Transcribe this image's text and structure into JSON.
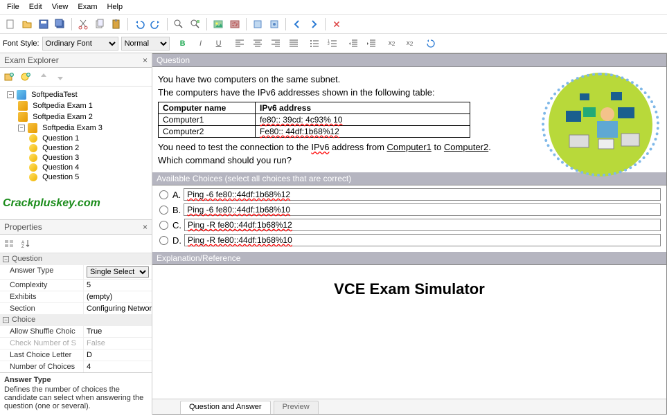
{
  "menu": {
    "file": "File",
    "edit": "Edit",
    "view": "View",
    "exam": "Exam",
    "help": "Help"
  },
  "format": {
    "fontstyle_label": "Font Style:",
    "fontstyle_value": "Ordinary Font",
    "fontsize_value": "Normal"
  },
  "explorer": {
    "title": "Exam Explorer",
    "root": "SoftpediaTest",
    "exams": [
      "Softpedia Exam 1",
      "Softpedia Exam 2",
      "Softpedia Exam 3"
    ],
    "questions": [
      "Question 1",
      "Question 2",
      "Question 3",
      "Question 4",
      "Question 5"
    ]
  },
  "watermark": "Crackpluskey.com",
  "properties": {
    "title": "Properties",
    "cat1": "Question",
    "rows1": [
      {
        "name": "Answer Type",
        "value": "Single Select",
        "select": true
      },
      {
        "name": "Complexity",
        "value": "5"
      },
      {
        "name": "Exhibits",
        "value": "(empty)"
      },
      {
        "name": "Section",
        "value": "Configuring Network C"
      }
    ],
    "cat2": "Choice",
    "rows2": [
      {
        "name": "Allow Shuffle Choic",
        "value": "True"
      },
      {
        "name": "Check Number of S",
        "value": "False",
        "disabled": true
      },
      {
        "name": "Last Choice Letter",
        "value": "D"
      },
      {
        "name": "Number of Choices",
        "value": "4"
      }
    ],
    "help_title": "Answer Type",
    "help_text": "Defines the number of choices the candidate can select when answering the question (one or several)."
  },
  "question": {
    "header": "Question",
    "p1": "You have two computers on the same subnet.",
    "p2": "The computers have the IPv6 addresses shown in the following table:",
    "table": {
      "h1": "Computer name",
      "h2": "IPv6 address",
      "r1c1": "Computer1",
      "r1c2": "fe80:: 39cd: 4c93% 10",
      "r2c1": "Computer2",
      "r2c2": "Fe80:: 44df:1b68%12"
    },
    "p3a": "You need to test the connection to the ",
    "p3b": "IPv6",
    "p3c": " address from ",
    "p3d": "Computer1",
    "p3e": " to ",
    "p3f": "Computer2",
    "p3g": ".",
    "p4": "Which command should you run?"
  },
  "choices": {
    "header": "Available Choices (select all choices that are correct)",
    "items": [
      {
        "letter": "A.",
        "text": "Ping -6 fe80::44df:1b68%12"
      },
      {
        "letter": "B.",
        "text": "Ping -6 fe80::44df:1b68%10"
      },
      {
        "letter": "C.",
        "text": "Ping -R fe80::44df:1b68%12"
      },
      {
        "letter": "D.",
        "text": "Ping -R fe80::44df:1b68%10"
      }
    ]
  },
  "explanation": {
    "header": "Explanation/Reference",
    "brand": "VCE Exam Simulator"
  },
  "tabs": {
    "qa": "Question and Answer",
    "preview": "Preview"
  }
}
